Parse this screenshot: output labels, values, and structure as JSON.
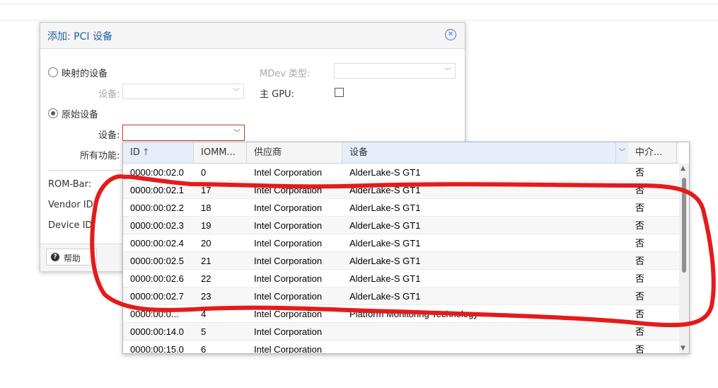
{
  "dialog": {
    "title": "添加: PCI 设备",
    "close_icon": "close-circle-icon",
    "mapped_device_label": "映射的设备",
    "device_label": "设备:",
    "mdev_type_label": "MDev 类型:",
    "primary_gpu_label": "主 GPU:",
    "raw_device_label": "原始设备",
    "raw_device_field_label": "设备:",
    "all_functions_label": "所有功能:",
    "rom_bar_label": "ROM-Bar:",
    "vendor_id_label": "Vendor ID:",
    "device_id_label": "Device ID:",
    "help_button": "帮助",
    "help_icon": "question-circle-icon"
  },
  "grid": {
    "columns": [
      "ID",
      "IOMM...",
      "供应商",
      "设备",
      "中介..."
    ],
    "sort_icon": "sort-ascending-icon",
    "rows": [
      {
        "id": "0000:00:02.0",
        "iommu": "0",
        "vendor": "Intel Corporation",
        "device": "AlderLake-S GT1",
        "mdev": "否"
      },
      {
        "id": "0000:00:02.1",
        "iommu": "17",
        "vendor": "Intel Corporation",
        "device": "AlderLake-S GT1",
        "mdev": "否"
      },
      {
        "id": "0000:00:02.2",
        "iommu": "18",
        "vendor": "Intel Corporation",
        "device": "AlderLake-S GT1",
        "mdev": "否"
      },
      {
        "id": "0000:00:02.3",
        "iommu": "19",
        "vendor": "Intel Corporation",
        "device": "AlderLake-S GT1",
        "mdev": "否"
      },
      {
        "id": "0000:00:02.4",
        "iommu": "20",
        "vendor": "Intel Corporation",
        "device": "AlderLake-S GT1",
        "mdev": "否"
      },
      {
        "id": "0000:00:02.5",
        "iommu": "21",
        "vendor": "Intel Corporation",
        "device": "AlderLake-S GT1",
        "mdev": "否"
      },
      {
        "id": "0000:00:02.6",
        "iommu": "22",
        "vendor": "Intel Corporation",
        "device": "AlderLake-S GT1",
        "mdev": "否"
      },
      {
        "id": "0000:00:02.7",
        "iommu": "23",
        "vendor": "Intel Corporation",
        "device": "AlderLake-S GT1",
        "mdev": "否"
      },
      {
        "id": "0000:00:0...",
        "iommu": "4",
        "vendor": "Intel Corporation",
        "device": "Platform Monitoring Technology",
        "mdev": "否"
      },
      {
        "id": "0000:00:14.0",
        "iommu": "5",
        "vendor": "Intel Corporation",
        "device": "",
        "mdev": "否"
      },
      {
        "id": "0000:00:15.0",
        "iommu": "6",
        "vendor": "Intel Corporation",
        "device": "",
        "mdev": "否"
      }
    ]
  },
  "colors": {
    "title": "#1f5f9f",
    "annotation": "#e41b1b",
    "active_border": "#c0392b"
  }
}
